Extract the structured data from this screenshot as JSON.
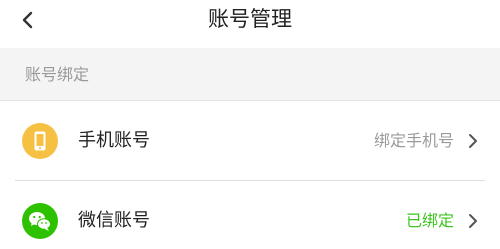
{
  "header": {
    "title": "账号管理",
    "back_icon": "back-chevron-icon"
  },
  "section": {
    "label": "账号绑定"
  },
  "rows": [
    {
      "label": "手机账号",
      "status": "绑定手机号",
      "status_color": "#9a9a9a",
      "icon": "phone-icon",
      "icon_color": "#f6c042"
    },
    {
      "label": "微信账号",
      "status": "已绑定",
      "status_color": "#3cc51f",
      "icon": "wechat-icon",
      "icon_color": "#2dc100"
    }
  ]
}
